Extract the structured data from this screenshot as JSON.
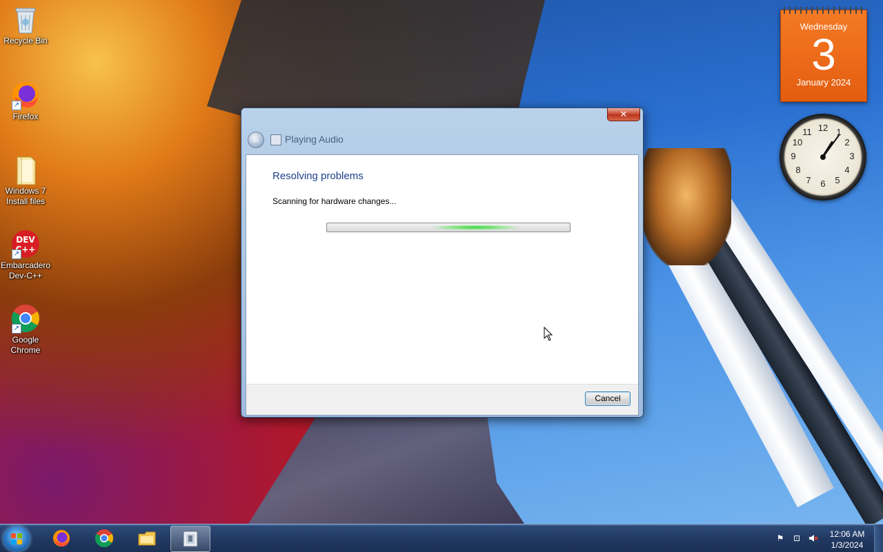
{
  "desktop": {
    "icons": [
      {
        "label": "Recycle Bin"
      },
      {
        "label": "Firefox"
      },
      {
        "label": "Windows 7 Install files"
      },
      {
        "label": "Embarcadero Dev-C++"
      },
      {
        "label": "Google Chrome"
      }
    ]
  },
  "gadgets": {
    "calendar": {
      "weekday": "Wednesday",
      "day": "3",
      "month_year": "January 2024"
    },
    "clock": {
      "numerals": [
        "12",
        "1",
        "2",
        "3",
        "4",
        "5",
        "6",
        "7",
        "8",
        "9",
        "10",
        "11"
      ],
      "time": "12:06"
    }
  },
  "window": {
    "title": "Playing Audio",
    "heading": "Resolving problems",
    "status": "Scanning for hardware changes...",
    "progress_mode": "indeterminate",
    "cancel_label": "Cancel",
    "close_glyph": "✕"
  },
  "taskbar": {
    "pinned": [
      "Firefox",
      "Google Chrome",
      "Windows Explorer",
      "Troubleshooter"
    ],
    "tray": {
      "time": "12:06 AM",
      "date": "1/3/2024"
    }
  },
  "icons": {
    "close": "close-icon",
    "back": "back-arrow-icon",
    "start": "windows-logo-icon"
  },
  "colors": {
    "calendar": "#e96318",
    "heading": "#1e3f8a",
    "progress_glow": "#36d43a"
  }
}
